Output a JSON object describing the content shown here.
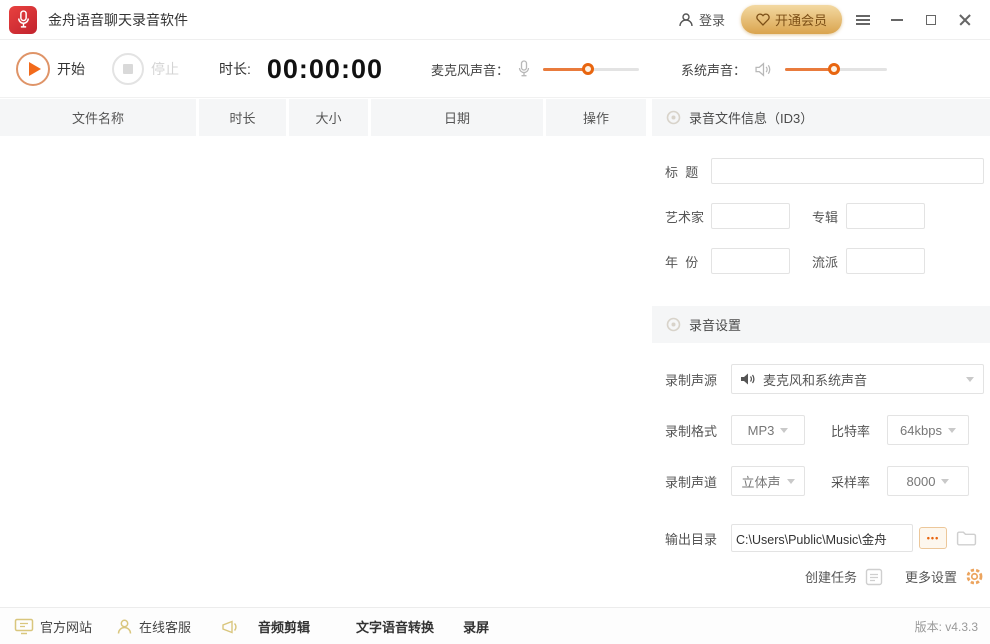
{
  "titlebar": {
    "app_title": "金舟语音聊天录音软件",
    "login_label": "登录",
    "vip_label": "开通会员"
  },
  "toolbar": {
    "start_label": "开始",
    "stop_label": "停止",
    "duration_label": "时长:",
    "duration_value": "00:00:00",
    "mic_volume_label": "麦克风声音：",
    "system_volume_label": "系统声音：",
    "mic_fill": "47%",
    "sys_fill": "48%"
  },
  "table": {
    "headers": [
      "文件名称",
      "时长",
      "大小",
      "日期",
      "操作"
    ]
  },
  "id3_panel": {
    "title": "录音文件信息（ID3）",
    "title_label": "标  题",
    "artist_label": "艺术家",
    "album_label": "专辑",
    "year_label": "年  份",
    "genre_label": "流派"
  },
  "settings_panel": {
    "title": "录音设置",
    "source_label": "录制声源",
    "source_value": "麦克风和系统声音",
    "format_label": "录制格式",
    "format_value": "MP3",
    "bitrate_label": "比特率",
    "bitrate_value": "64kbps",
    "channel_label": "录制声道",
    "channel_value": "立体声",
    "samplerate_label": "采样率",
    "samplerate_value": "8000",
    "output_label": "输出目录",
    "output_value": "C:\\Users\\Public\\Music\\金舟",
    "browse_label": "•••",
    "create_task_label": "创建任务",
    "more_settings_label": "更多设置"
  },
  "footer": {
    "website_label": "官方网站",
    "support_label": "在线客服",
    "audio_edit_label": "音频剪辑",
    "tts_label": "文字语音转换",
    "screen_record_label": "录屏",
    "version_label": "版本: v4.3.3"
  },
  "colors": {
    "accent_orange": "#f26a1b",
    "vip_gold": "#daa44e",
    "logo_red": "#c2232e",
    "header_gray": "#f5f6f7"
  }
}
